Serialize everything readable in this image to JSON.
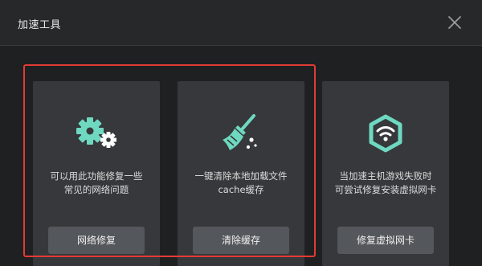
{
  "window": {
    "title": "加速工具"
  },
  "colors": {
    "accent": "#6fd8c0",
    "highlight_border": "#e23b35",
    "card_bg": "#36383b",
    "button_bg": "#54575b"
  },
  "cards": [
    {
      "icon": "gears-icon",
      "desc_line1": "可以用此功能修复一些",
      "desc_line2": "常见的网络问题",
      "button_label": "网络修复"
    },
    {
      "icon": "broom-icon",
      "desc_line1": "一键清除本地加载文件",
      "desc_line2": "cache缓存",
      "button_label": "清除缓存"
    },
    {
      "icon": "wifi-shield-icon",
      "desc_line1": "当加速主机游戏失败时",
      "desc_line2": "可尝试修复安装虚拟网卡",
      "button_label": "修复虚拟网卡"
    }
  ]
}
